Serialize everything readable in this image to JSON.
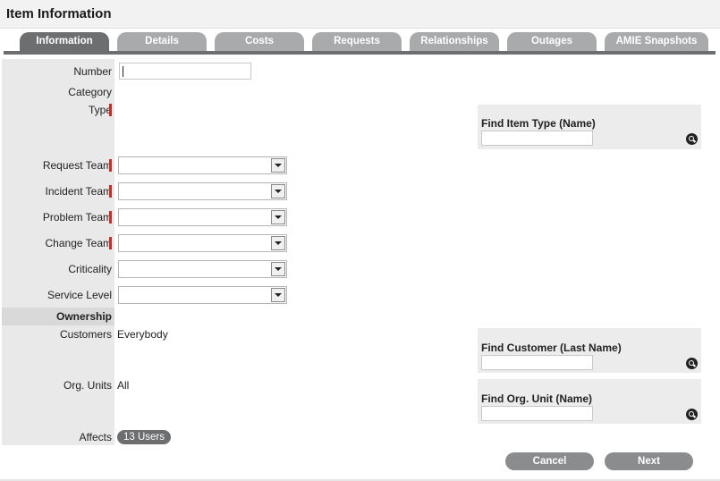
{
  "header": {
    "title": "Item Information"
  },
  "tabs": [
    {
      "label": "Information",
      "active": true
    },
    {
      "label": "Details",
      "active": false
    },
    {
      "label": "Costs",
      "active": false
    },
    {
      "label": "Requests",
      "active": false
    },
    {
      "label": "Relationships",
      "active": false
    },
    {
      "label": "Outages",
      "active": false
    },
    {
      "label": "AMIE Snapshots",
      "active": false
    }
  ],
  "fields": {
    "number": {
      "label": "Number",
      "value": ""
    },
    "category": {
      "label": "Category"
    },
    "type": {
      "label": "Type"
    },
    "request_team": {
      "label": "Request Team",
      "value": ""
    },
    "incident_team": {
      "label": "Incident Team",
      "value": ""
    },
    "problem_team": {
      "label": "Problem Team",
      "value": ""
    },
    "change_team": {
      "label": "Change Team",
      "value": ""
    },
    "criticality": {
      "label": "Criticality",
      "value": ""
    },
    "service_level": {
      "label": "Service Level",
      "value": ""
    }
  },
  "ownership": {
    "section_title": "Ownership",
    "customers": {
      "label": "Customers",
      "value": "Everybody"
    },
    "org_units": {
      "label": "Org. Units",
      "value": "All"
    },
    "affects": {
      "label": "Affects",
      "value": "13 Users"
    }
  },
  "panels": {
    "item_type": {
      "title": "Find Item Type (Name)",
      "value": ""
    },
    "customer": {
      "title": "Find Customer (Last Name)",
      "value": ""
    },
    "org_unit": {
      "title": "Find Org. Unit (Name)",
      "value": ""
    }
  },
  "buttons": {
    "cancel": "Cancel",
    "next": "Next"
  },
  "colors": {
    "tab_active": "#6c6e70",
    "tab_inactive": "#a8aaac",
    "required_marker": "#c0302b",
    "button": "#8a8c8e"
  }
}
